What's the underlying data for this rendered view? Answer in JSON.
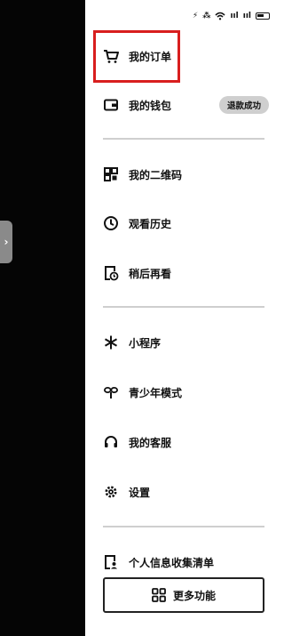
{
  "status_bar": {
    "icons": [
      "wifi-icon",
      "signal-icon",
      "signal-icon",
      "battery-icon"
    ],
    "glyph_a": "⚡",
    "glyph_b": "⁂",
    "glyph_c": "ııl",
    "glyph_d": "ııl"
  },
  "edge_handle": {
    "glyph": "›"
  },
  "menu": {
    "orders": {
      "label": "我的订单",
      "icon": "cart-icon"
    },
    "wallet": {
      "label": "我的钱包",
      "icon": "wallet-icon",
      "badge": "退款成功"
    },
    "qrcode": {
      "label": "我的二维码",
      "icon": "qr-code-icon"
    },
    "history": {
      "label": "观看历史",
      "icon": "clock-icon"
    },
    "watch_later": {
      "label": "稍后再看",
      "icon": "watch-later-icon"
    },
    "mini_programs": {
      "label": "小程序",
      "icon": "asterisk-icon"
    },
    "youth_mode": {
      "label": "青少年模式",
      "icon": "sprout-icon"
    },
    "customer_service": {
      "label": "我的客服",
      "icon": "headset-icon"
    },
    "settings": {
      "label": "设置",
      "icon": "gear-icon"
    },
    "personal_info": {
      "label": "个人信息收集清单",
      "icon": "info-list-icon"
    }
  },
  "more_button": {
    "label": "更多功能",
    "icon": "grid-icon"
  },
  "colors": {
    "highlight": "#d81e1e",
    "badge_bg": "#cfcfcf",
    "divider": "#cfcfcf"
  }
}
